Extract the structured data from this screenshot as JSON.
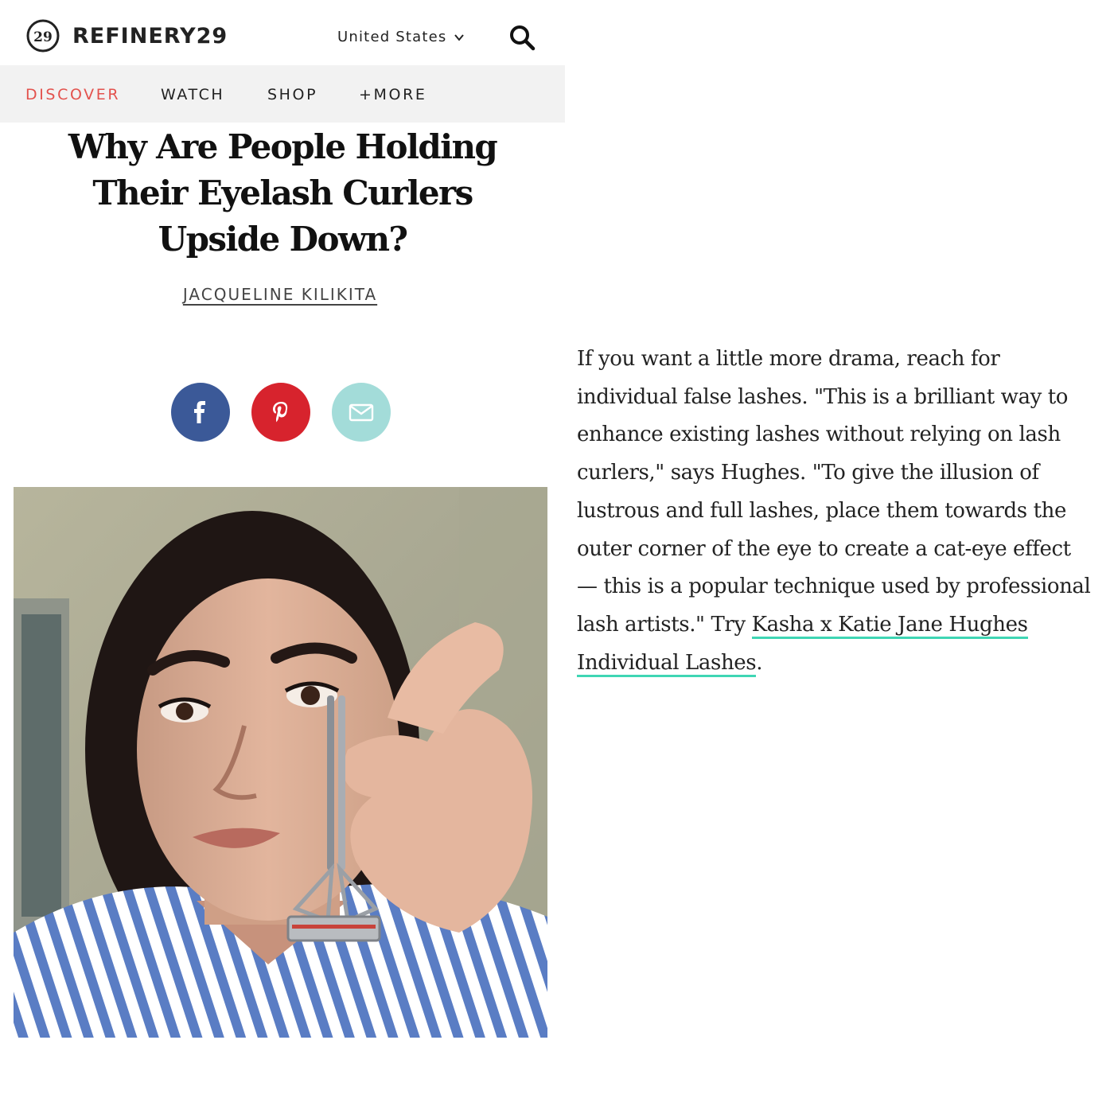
{
  "header": {
    "logo_text": "REFINERY29",
    "logo_mark_text": "29",
    "country_selector": "United States",
    "icons": {
      "search": "search-icon",
      "country_dropdown": "chevron-down-icon",
      "logo": "refinery29-logo-icon"
    }
  },
  "nav": {
    "items": [
      {
        "label": "DISCOVER",
        "active": true
      },
      {
        "label": "WATCH",
        "active": false
      },
      {
        "label": "SHOP",
        "active": false
      },
      {
        "label": "+MORE",
        "active": false
      }
    ],
    "active_color": "#e3524d"
  },
  "article": {
    "title": "Why Are People Holding Their Eyelash Curlers Upside Down?",
    "author": "JACQUELINE KILIKITA",
    "share_buttons": [
      {
        "icon": "facebook-icon",
        "color": "#3b5998"
      },
      {
        "icon": "pinterest-icon",
        "color": "#d7232d"
      },
      {
        "icon": "email-icon",
        "color": "#a3dcd9"
      }
    ],
    "image": {
      "subject": "woman holding an eyelash curler upside down"
    }
  },
  "body": {
    "text_before_link": "If you want a little more drama, reach for individual false lashes. \"This is a brilliant way to enhance existing lashes without relying on lash curlers,\" says Hughes. \"To give the illusion of lustrous and full lashes, place them towards the outer corner of the eye to create a cat-eye effect — this is a popular technique used by professional lash artists.\" Try ",
    "link_text": "Kasha x Katie Jane Hughes Individual Lashes",
    "text_after_link": ".",
    "link_underline_color": "#3fd6b4"
  }
}
